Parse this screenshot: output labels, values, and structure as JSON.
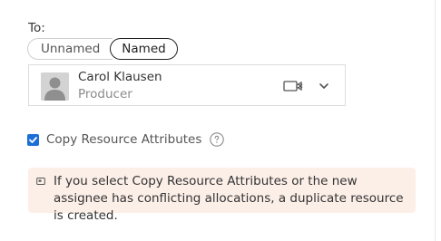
{
  "to_label": "To:",
  "toggle": {
    "unnamed_label": "Unnamed",
    "named_label": "Named",
    "selected": "Named"
  },
  "resource": {
    "name": "Carol Klausen",
    "role": "Producer"
  },
  "copy_attributes": {
    "label": "Copy Resource Attributes",
    "checked": true
  },
  "notice": {
    "text": "If you select Copy Resource Attributes or the new assignee has conflicting allocations, a duplicate resource is created."
  },
  "colors": {
    "accent": "#1a6fd8",
    "notice_bg": "#fcefe8"
  },
  "icons": [
    "person-avatar-icon",
    "video-off-icon",
    "chevron-down-icon",
    "checkbox-checked-icon",
    "help-circle-icon",
    "notice-icon"
  ]
}
